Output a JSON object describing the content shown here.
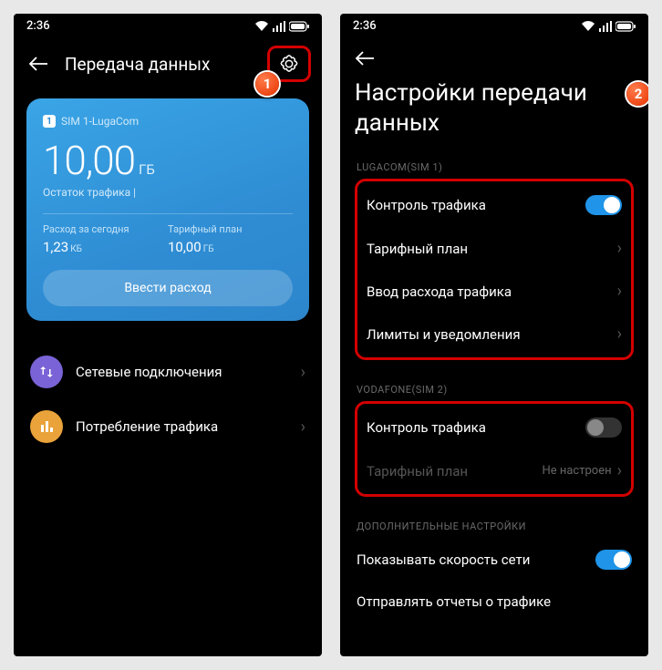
{
  "status": {
    "time": "2:36"
  },
  "left": {
    "title": "Передача данных",
    "card": {
      "sim": "SIM 1-LugaCom",
      "amount": "10,00",
      "unit": "ГБ",
      "remain": "Остаток трафика |",
      "today_label": "Расход за сегодня",
      "today_value": "1,23",
      "today_unit": "КБ",
      "plan_label": "Тарифный план",
      "plan_value": "10,00",
      "plan_unit": "ГБ",
      "button": "Ввести расход"
    },
    "rows": {
      "network": "Сетевые подключения",
      "usage": "Потребление трафика"
    }
  },
  "right": {
    "title": "Настройки передачи данных",
    "sim1_header": "LUGACOM(SIM 1)",
    "sim1": {
      "traffic_control": "Контроль трафика",
      "plan": "Тарифный план",
      "input": "Ввод расхода трафика",
      "limits": "Лимиты и уведомления"
    },
    "sim2_header": "VODAFONE(SIM 2)",
    "sim2": {
      "traffic_control": "Контроль трафика",
      "plan": "Тарифный план",
      "plan_value": "Не настроен"
    },
    "extra_header": "ДОПОЛНИТЕЛЬНЫЕ НАСТРОЙКИ",
    "extra": {
      "speed": "Показывать скорость сети",
      "reports": "Отправлять отчеты о трафике"
    }
  },
  "callouts": {
    "one": "1",
    "two": "2"
  }
}
